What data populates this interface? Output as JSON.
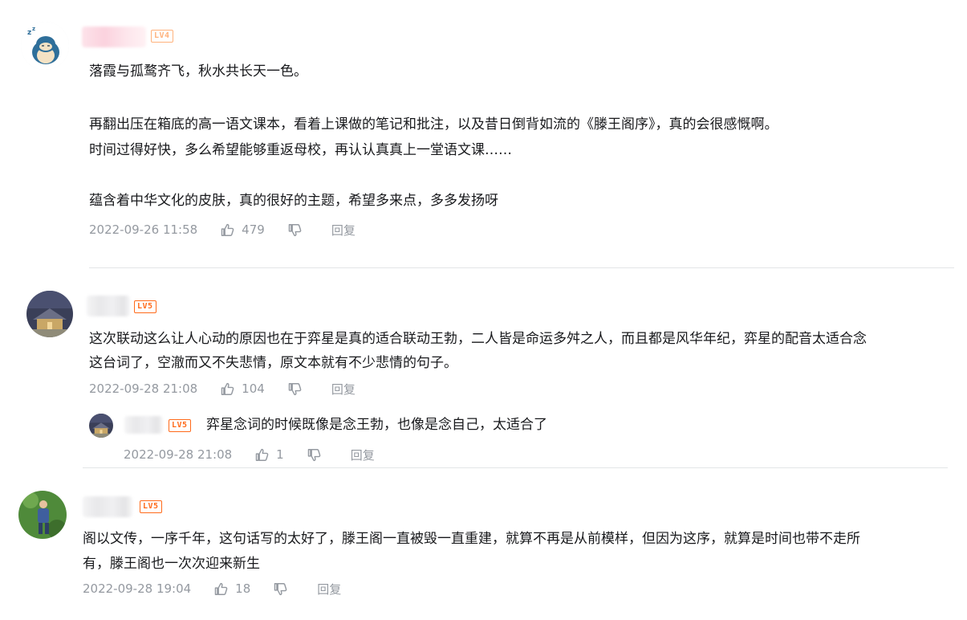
{
  "comments": [
    {
      "level": "LV4",
      "lines": [
        "落霞与孤鹜齐飞，秋水共长天一色。",
        "",
        "再翻出压在箱底的高一语文课本，看着上课做的笔记和批注，以及昔日倒背如流的《滕王阁序》，真的会很感慨啊。",
        "时间过得好快，多么希望能够重返母校，再认认真真上一堂语文课……",
        "",
        "蕴含着中华文化的皮肤，真的很好的主题，希望多来点，多多发扬呀"
      ],
      "time": "2022-09-26 11:58",
      "likes": "479",
      "reply_label": "回复"
    },
    {
      "level": "LV5",
      "lines": [
        "这次联动这么让人心动的原因也在于弈星是真的适合联动王勃，二人皆是命运多舛之人，而且都是风华年纪，弈星的配音太适合念",
        "这台词了，空澈而又不失悲情，原文本就有不少悲情的句子。"
      ],
      "time": "2022-09-28 21:08",
      "likes": "104",
      "reply_label": "回复",
      "replies": [
        {
          "level": "LV5",
          "text": "弈星念词的时候既像是念王勃，也像是念自己，太适合了",
          "time": "2022-09-28 21:08",
          "likes": "1",
          "reply_label": "回复"
        }
      ]
    },
    {
      "level": "LV5",
      "lines": [
        "阁以文传，一序千年，这句话写的太好了，滕王阁一直被毁一直重建，就算不再是从前模样，但因为这序，就算是时间也带不走所",
        "有，滕王阁也一次次迎来新生"
      ],
      "time": "2022-09-28 19:04",
      "likes": "18",
      "reply_label": "回复"
    }
  ],
  "icons": {
    "like": "thumb-up-icon",
    "dislike": "thumb-down-icon"
  },
  "colors": {
    "level_badge": "#ff6a1a",
    "level_badge_lv4": "#ffb27c",
    "meta_text": "#9499a0",
    "divider": "#e3e5e7"
  }
}
